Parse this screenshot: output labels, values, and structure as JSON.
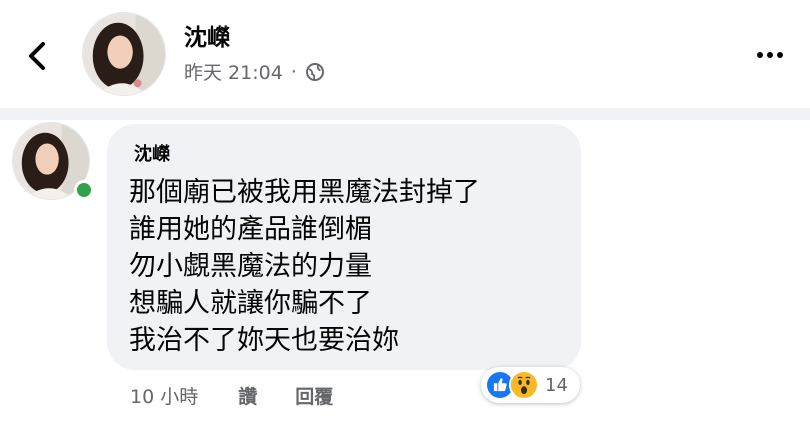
{
  "post": {
    "author": "沈嶸",
    "timestamp": "昨天 21:04",
    "separator": "·",
    "privacy_icon": "globe-icon"
  },
  "comment": {
    "author": "沈嶸",
    "lines": [
      "那個廟已被我用黑魔法封掉了",
      "誰用她的產品誰倒楣",
      "勿小覷黑魔法的力量",
      "想騙人就讓你騙不了",
      "我治不了妳天也要治妳"
    ],
    "time": "10 小時",
    "like_label": "讚",
    "reply_label": "回覆",
    "reactions": {
      "icons": [
        "like-icon",
        "wow-icon"
      ],
      "count": "14"
    }
  },
  "colors": {
    "online": "#31a24c",
    "like_blue": "#1877f2",
    "wow_yellow": "#f7b928",
    "bubble": "#f0f2f5",
    "secondary_text": "#65676b"
  },
  "icons": {
    "back": "chevron-left-icon",
    "more": "more-horizontal-icon"
  }
}
